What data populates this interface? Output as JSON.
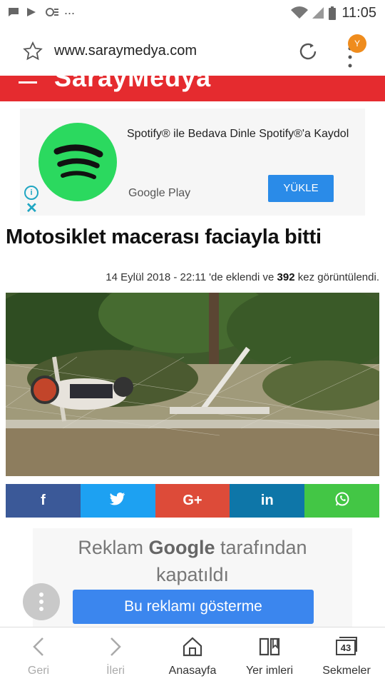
{
  "status_bar": {
    "time": "11:05",
    "ellipsis": "..."
  },
  "browser": {
    "url": "www.saraymedya.com",
    "avatar_letter": "Y"
  },
  "site": {
    "logo": "SarayMedya"
  },
  "ad": {
    "text": "Spotify® ile Bedava Dinle Spotify®'a Kaydol",
    "store": "Google Play",
    "button": "YÜKLE",
    "info_icon": "i",
    "close_icon": "✕"
  },
  "article": {
    "title": "Motosiklet macerası faciayla bitti",
    "date": "14 Eylül 2018 - 22:11",
    "added_text": "'de eklendi ve",
    "views": "392",
    "views_suffix": "kez görüntülendi."
  },
  "share": [
    {
      "label": "f",
      "color": "#3b5998",
      "name": "facebook"
    },
    {
      "label": "🐦",
      "color": "#1da1f2",
      "name": "twitter"
    },
    {
      "label": "G+",
      "color": "#dd4b39",
      "name": "google-plus"
    },
    {
      "label": "in",
      "color": "#0e76a8",
      "name": "linkedin"
    },
    {
      "label": "✆",
      "color": "#43c645",
      "name": "whatsapp"
    }
  ],
  "closed_ad": {
    "line1_a": "Reklam",
    "line1_g": "Google",
    "line1_b": "tarafından",
    "line2": "kapatıldı",
    "button": "Bu reklamı gösterme"
  },
  "bottom_nav": {
    "back": "Geri",
    "forward": "İleri",
    "home": "Anasayfa",
    "bookmarks": "Yer imleri",
    "tabs": "Sekmeler",
    "tab_count": "43"
  }
}
